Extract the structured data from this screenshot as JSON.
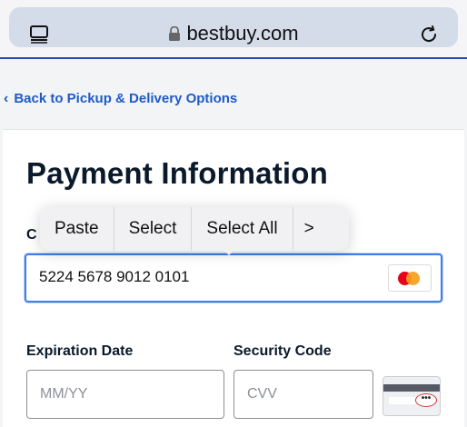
{
  "browser": {
    "url": "bestbuy.com"
  },
  "nav": {
    "back_label": "Back to Pickup & Delivery Options"
  },
  "page": {
    "title": "Payment Information",
    "card_label": "C"
  },
  "card_number": {
    "value": "5224 5678 9012 0101",
    "brand_icon": "mastercard-icon"
  },
  "context_menu": {
    "items": [
      "Paste",
      "Select",
      "Select All"
    ],
    "more_icon": ">"
  },
  "expiration": {
    "label": "Expiration Date",
    "placeholder": "MM/YY"
  },
  "security": {
    "label": "Security Code",
    "placeholder": "CVV",
    "dots": "•••"
  },
  "colors": {
    "accent": "#1e5ac8",
    "focus": "#3c7fe8",
    "mastercard_red": "#eb001b",
    "mastercard_orange": "#f79e1b"
  }
}
